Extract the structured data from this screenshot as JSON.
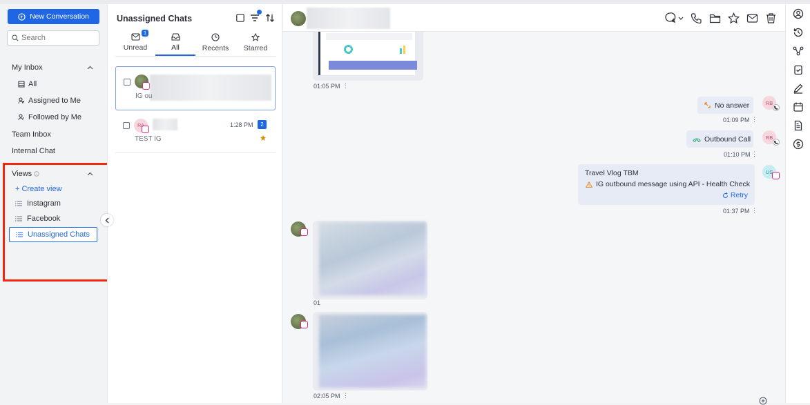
{
  "sidebar": {
    "new_conversation": "New Conversation",
    "search_placeholder": "Search",
    "my_inbox": "My Inbox",
    "inbox_items": [
      "All",
      "Assigned to Me",
      "Followed by Me"
    ],
    "team_inbox": "Team Inbox",
    "internal_chat": "Internal Chat",
    "views_label": "Views",
    "create_view": "+ Create view",
    "views": [
      "Instagram",
      "Facebook",
      "Unassigned Chats"
    ]
  },
  "list": {
    "title": "Unassigned Chats",
    "tabs": [
      {
        "label": "Unread",
        "badge": "1"
      },
      {
        "label": "All"
      },
      {
        "label": "Recents"
      },
      {
        "label": "Starred"
      }
    ],
    "chats": [
      {
        "preview": "IG ou"
      },
      {
        "avatar": "RA",
        "time": "1:28 PM",
        "count": "2",
        "preview": "TEST IG"
      }
    ]
  },
  "chat": {
    "messages": [
      {
        "time": "01:05 PM"
      },
      {
        "text": "No answer",
        "time": "01:09 PM",
        "avatar": "RB"
      },
      {
        "text": "Outbound Call",
        "time": "01:10 PM",
        "avatar": "RB"
      },
      {
        "title": "Travel Vlog TBM",
        "text": "IG outbound message using API - Health Check",
        "retry": "Retry",
        "time": "01:37 PM",
        "avatar": "US"
      },
      {
        "time": "01"
      },
      {
        "time": "02:05 PM"
      }
    ]
  },
  "colors": {
    "accent": "#1f66e5",
    "highlight": "#f0280e",
    "bubble": "#e7ebf5"
  }
}
